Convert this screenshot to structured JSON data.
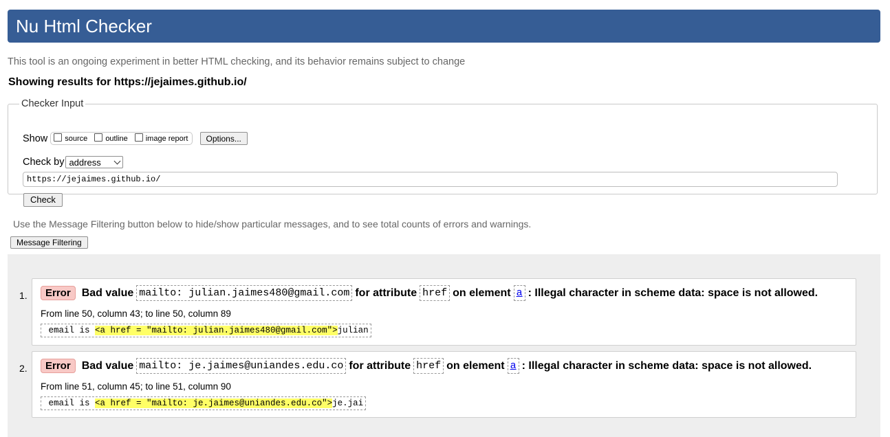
{
  "header": {
    "title": "Nu Html Checker"
  },
  "tagline": "This tool is an ongoing experiment in better HTML checking, and its behavior remains subject to change",
  "results_heading": "Showing results for https://jejaimes.github.io/",
  "checker_input": {
    "legend": "Checker Input",
    "show_label": "Show",
    "show_options": [
      {
        "label": "source",
        "checked": false
      },
      {
        "label": "outline",
        "checked": false
      },
      {
        "label": "image report",
        "checked": false
      }
    ],
    "options_button": "Options...",
    "check_by_label": "Check by",
    "check_by_value": "address",
    "url_value": "https://jejaimes.github.io/",
    "check_button": "Check"
  },
  "filter_note": "Use the Message Filtering button below to hide/show particular messages, and to see total counts of errors and warnings.",
  "filter_button": "Message Filtering",
  "messages": [
    {
      "number": "1.",
      "type": "Error",
      "text_prefix": "Bad value",
      "value": "mailto: julian.jaimes480@gmail.com",
      "text_mid1": "for attribute",
      "attribute": "href",
      "text_mid2": "on element",
      "element": "a",
      "text_suffix": ": Illegal character in scheme data: space is not allowed.",
      "location": "From line 50, column 43; to line 50, column 89",
      "extract_before": " email is ",
      "extract_highlight": "<a href = \"mailto: julian.jaimes480@gmail.com\">",
      "extract_after": "julian"
    },
    {
      "number": "2.",
      "type": "Error",
      "text_prefix": "Bad value",
      "value": "mailto: je.jaimes@uniandes.edu.co",
      "text_mid1": "for attribute",
      "attribute": "href",
      "text_mid2": "on element",
      "element": "a",
      "text_suffix": ": Illegal character in scheme data: space is not allowed.",
      "location": "From line 51, column 45; to line 51, column 90",
      "extract_before": " email is ",
      "extract_highlight": "<a href = \"mailto: je.jaimes@uniandes.edu.co\">",
      "extract_after": "je.jai"
    }
  ],
  "colors": {
    "header_bg": "#365d95",
    "error_badge_bg": "#f8c9c6",
    "highlight": "#ffff66",
    "results_bg": "#eeeeee"
  }
}
